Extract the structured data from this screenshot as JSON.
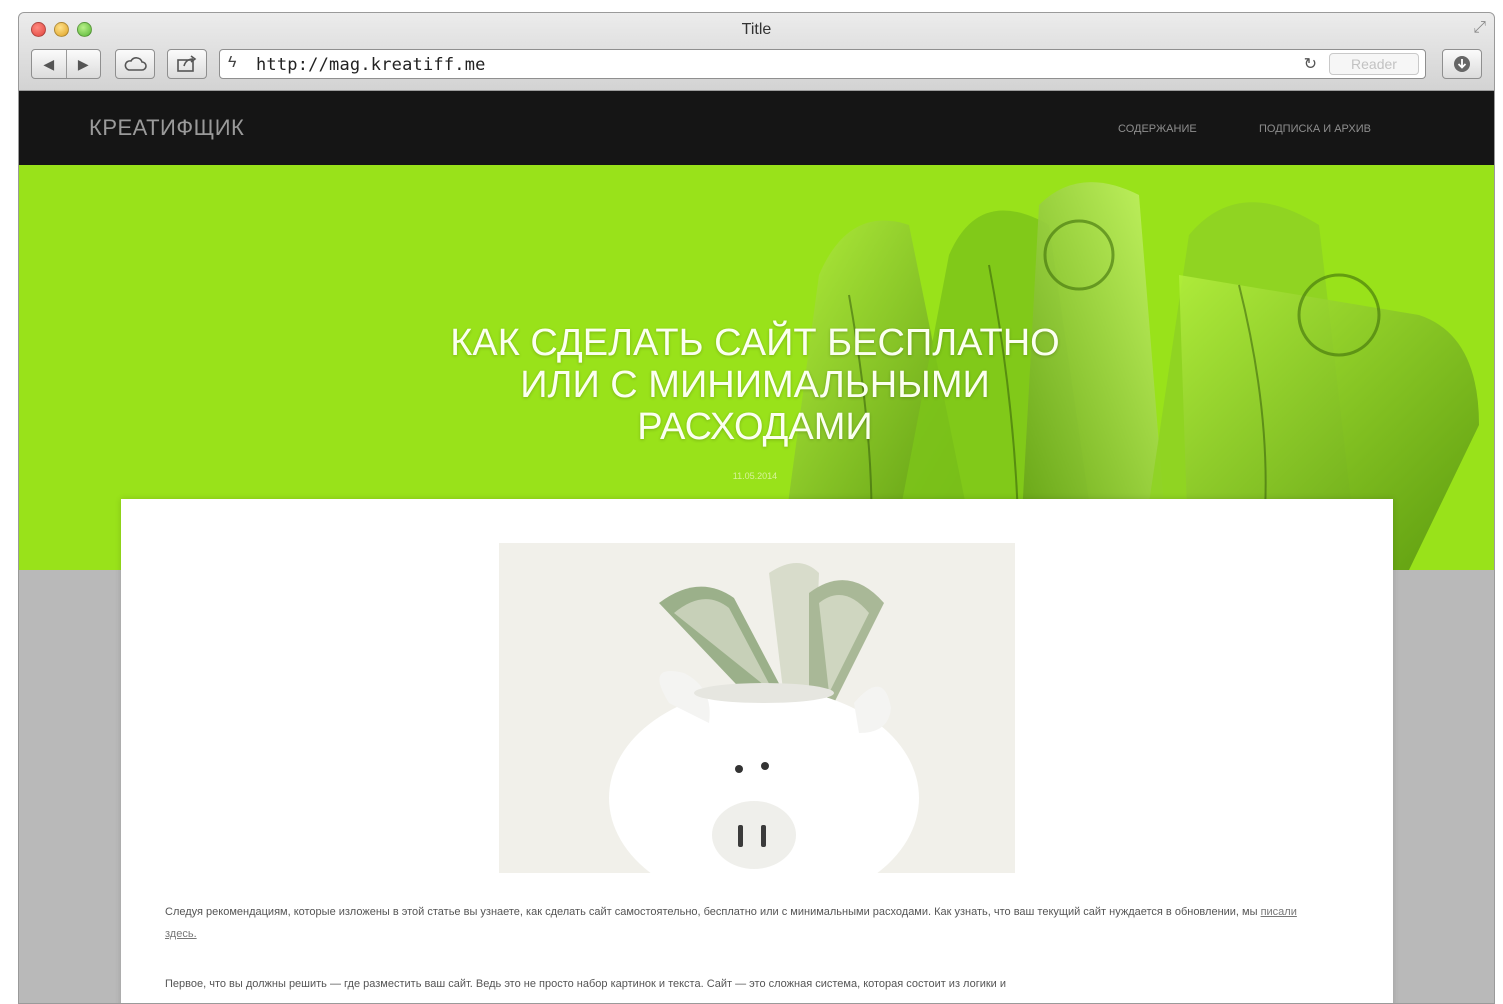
{
  "browser": {
    "window_title": "Title",
    "url": "http://mag.kreatiff.me",
    "reader_label": "Reader"
  },
  "site": {
    "logo": "КРЕАТИФЩИК",
    "menu": [
      "СОДЕРЖАНИЕ",
      "ПОДПИСКА И АРХИВ"
    ]
  },
  "hero": {
    "title": "КАК СДЕЛАТЬ САЙТ БЕСПЛАТНО ИЛИ С МИНИМАЛЬНЫМИ РАСХОДАМИ",
    "date": "11.05.2014",
    "accent_color": "#99e21a"
  },
  "article": {
    "paragraph1": "Следуя рекомендациям, которые изложены в этой статье вы узнаете, как сделать сайт самостоятельно, бесплатно или с минимальными расходами. Как узнать, что ваш текущий сайт нуждается в обновлении, мы",
    "paragraph1_link": "писали здесь.",
    "paragraph2": "Первое, что вы должны решить — где разместить ваш сайт. Ведь это не просто набор картинок и текста. Сайт — это сложная система, которая состоит из логики и"
  },
  "icons": {
    "back": "back-arrow-icon",
    "forward": "forward-arrow-icon",
    "cloud": "cloud-icon",
    "share": "share-icon",
    "site": "site-icon",
    "reload": "reload-icon",
    "download": "download-icon"
  }
}
